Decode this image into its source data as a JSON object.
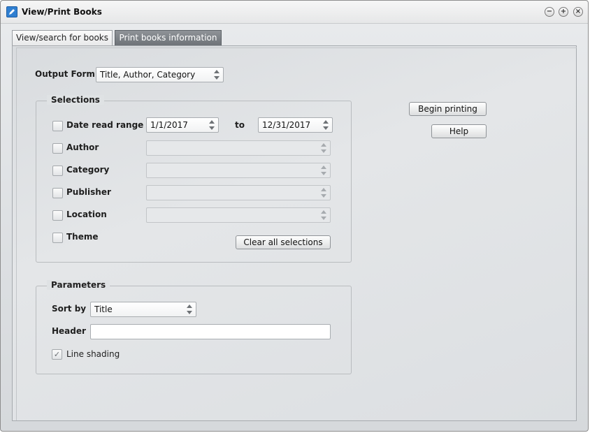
{
  "window": {
    "title": "View/Print Books",
    "controls": {
      "minimize": "−",
      "maximize": "+",
      "close": "×"
    }
  },
  "tabs": [
    {
      "label": "View/search for books",
      "active": false
    },
    {
      "label": "Print books information",
      "active": true
    }
  ],
  "output_form": {
    "label": "Output Form",
    "value": "Title, Author, Category"
  },
  "selections": {
    "legend": "Selections",
    "date_read_range": {
      "label": "Date read range",
      "checked": false,
      "from": "1/1/2017",
      "to_label": "to",
      "to": "12/31/2017"
    },
    "author": {
      "label": "Author",
      "checked": false,
      "value": ""
    },
    "category": {
      "label": "Category",
      "checked": false,
      "value": ""
    },
    "publisher": {
      "label": "Publisher",
      "checked": false,
      "value": ""
    },
    "location": {
      "label": "Location",
      "checked": false,
      "value": ""
    },
    "theme": {
      "label": "Theme",
      "checked": false
    },
    "clear_button": "Clear all selections"
  },
  "parameters": {
    "legend": "Parameters",
    "sort_by": {
      "label": "Sort by",
      "value": "Title"
    },
    "header": {
      "label": "Header",
      "value": ""
    },
    "line_shading": {
      "label": "Line shading",
      "checked": true,
      "glyph": "✓"
    }
  },
  "actions": {
    "begin_printing": "Begin printing",
    "help": "Help"
  },
  "colors": {
    "active_tab": "#7a7f84",
    "app_icon": "#2f7fd1"
  }
}
